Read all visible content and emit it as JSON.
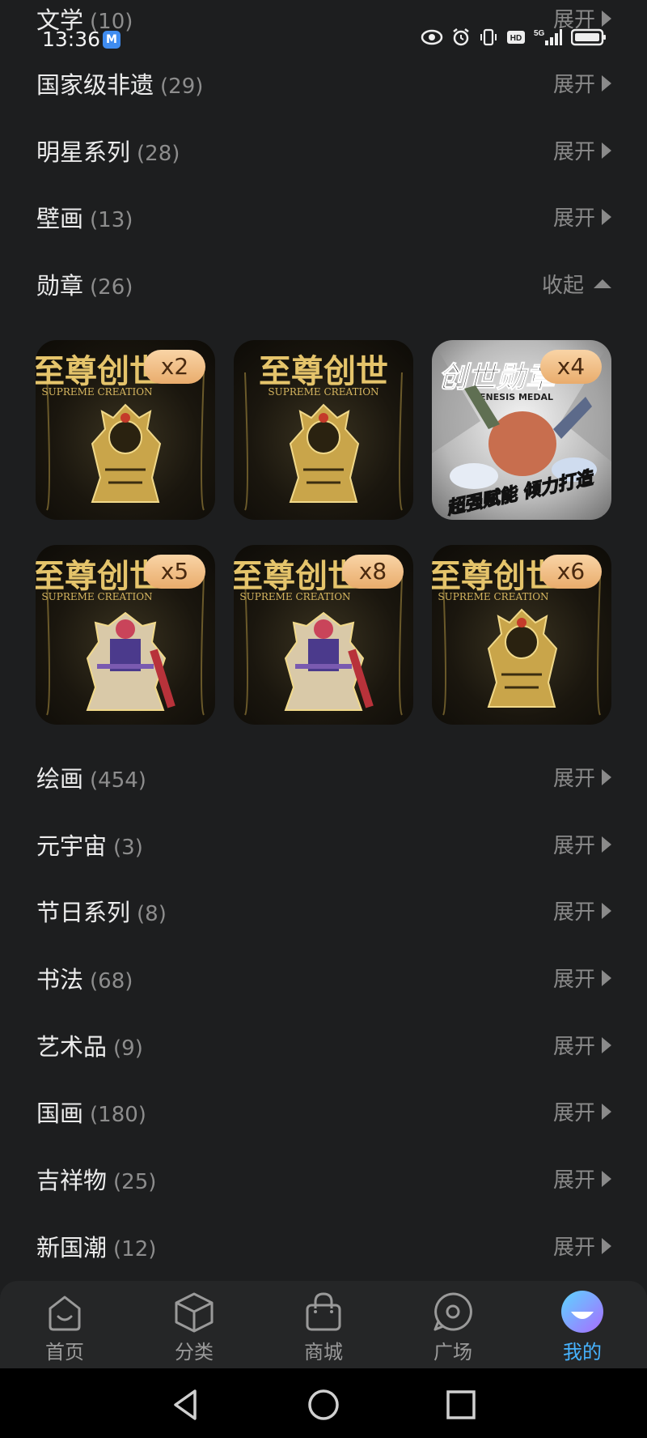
{
  "status_bar": {
    "time": "13:36",
    "app_icon": "M",
    "icons": [
      "eye-icon",
      "alarm-icon",
      "vibrate-icon",
      "hd-icon",
      "5g-signal-icon",
      "battery-icon"
    ]
  },
  "categories": [
    {
      "name": "文学",
      "count": "(10)",
      "toggle": "展开",
      "expanded": false
    },
    {
      "name": "国家级非遗",
      "count": "(29)",
      "toggle": "展开",
      "expanded": false
    },
    {
      "name": "明星系列",
      "count": "(28)",
      "toggle": "展开",
      "expanded": false
    },
    {
      "name": "壁画",
      "count": "(13)",
      "toggle": "展开",
      "expanded": false
    },
    {
      "name": "勋章",
      "count": "(26)",
      "toggle": "收起",
      "expanded": true
    },
    {
      "name": "绘画",
      "count": "(454)",
      "toggle": "展开",
      "expanded": false
    },
    {
      "name": "元宇宙",
      "count": "(3)",
      "toggle": "展开",
      "expanded": false
    },
    {
      "name": "节日系列",
      "count": "(8)",
      "toggle": "展开",
      "expanded": false
    },
    {
      "name": "书法",
      "count": "(68)",
      "toggle": "展开",
      "expanded": false
    },
    {
      "name": "艺术品",
      "count": "(9)",
      "toggle": "展开",
      "expanded": false
    },
    {
      "name": "国画",
      "count": "(180)",
      "toggle": "展开",
      "expanded": false
    },
    {
      "name": "吉祥物",
      "count": "(25)",
      "toggle": "展开",
      "expanded": false
    },
    {
      "name": "新国潮",
      "count": "(12)",
      "toggle": "展开",
      "expanded": false
    }
  ],
  "medals": [
    {
      "title": "至尊创世",
      "subtitle": "SUPREME CREATION",
      "badge": "x2",
      "art": "gold-warrior"
    },
    {
      "title": "至尊创世",
      "subtitle": "SUPREME CREATION",
      "badge": "",
      "art": "gold-warrior"
    },
    {
      "title": "创世勋章",
      "subtitle": "GENESIS MEDAL",
      "badge": "x4",
      "art": "genesis",
      "tagline": "超强赋能 倾力打造"
    },
    {
      "title": "至尊创世",
      "subtitle": "SUPREME CREATION",
      "badge": "x5",
      "art": "color-warrior"
    },
    {
      "title": "至尊创世",
      "subtitle": "SUPREME CREATION",
      "badge": "x8",
      "art": "color-warrior"
    },
    {
      "title": "至尊创世",
      "subtitle": "SUPREME CREATION",
      "badge": "x6",
      "art": "gold-warrior"
    }
  ],
  "tab_bar": {
    "items": [
      {
        "label": "首页",
        "icon": "home-icon",
        "active": false
      },
      {
        "label": "分类",
        "icon": "cube-icon",
        "active": false
      },
      {
        "label": "商城",
        "icon": "shopping-bag-icon",
        "active": false
      },
      {
        "label": "广场",
        "icon": "chat-bubble-icon",
        "active": false
      },
      {
        "label": "我的",
        "icon": "profile-face-icon",
        "active": true
      }
    ],
    "active_color": "#47b3ff"
  },
  "nav_bar": {
    "buttons": [
      "back-icon",
      "home-circle-icon",
      "recents-square-icon"
    ]
  }
}
